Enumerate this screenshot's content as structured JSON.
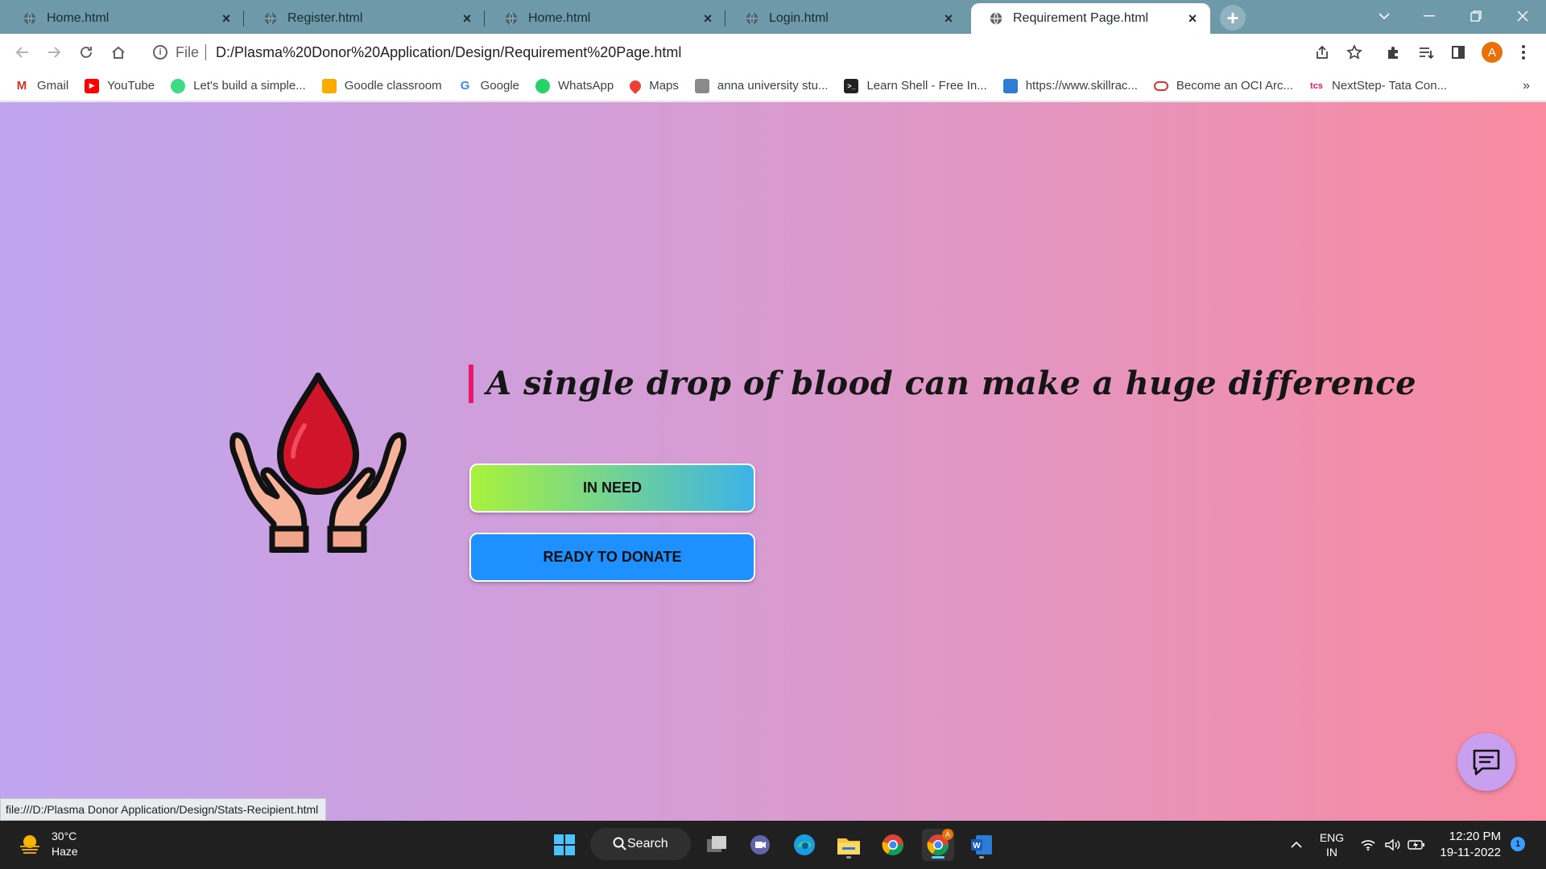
{
  "browser": {
    "tabs": [
      {
        "title": "Home.html",
        "active": false
      },
      {
        "title": "Register.html",
        "active": false
      },
      {
        "title": "Home.html",
        "active": false
      },
      {
        "title": "Login.html",
        "active": false
      },
      {
        "title": "Requirement Page.html",
        "active": true
      }
    ],
    "address": {
      "scheme": "File",
      "url": "D:/Plasma%20Donor%20Application/Design/Requirement%20Page.html"
    },
    "profile_initial": "A",
    "bookmarks": [
      {
        "label": "Gmail",
        "icon": "gmail-icon"
      },
      {
        "label": "YouTube",
        "icon": "youtube-icon"
      },
      {
        "label": "Let's build a simple...",
        "icon": "android-icon"
      },
      {
        "label": "Goodle classroom",
        "icon": "classroom-icon"
      },
      {
        "label": "Google",
        "icon": "google-icon"
      },
      {
        "label": "WhatsApp",
        "icon": "whatsapp-icon"
      },
      {
        "label": "Maps",
        "icon": "maps-pin-icon"
      },
      {
        "label": "anna university stu...",
        "icon": "university-icon"
      },
      {
        "label": "Learn Shell - Free In...",
        "icon": "terminal-icon"
      },
      {
        "label": "https://www.skillrac...",
        "icon": "skillrack-icon"
      },
      {
        "label": "Become an OCI Arc...",
        "icon": "oracle-icon"
      },
      {
        "label": "NextStep- Tata Con...",
        "icon": "tcs-icon"
      }
    ],
    "bookmarks_more": "»"
  },
  "page": {
    "headline": "A single drop of blood can make a huge difference",
    "buttons": {
      "in_need": "IN NEED",
      "ready_to_donate": "READY TO DONATE"
    },
    "status_url": "file:///D:/Plasma Donor Application/Design/Stats-Recipient.html"
  },
  "taskbar": {
    "weather": {
      "temp": "30°C",
      "condition": "Haze"
    },
    "search_label": "Search",
    "language": {
      "line1": "ENG",
      "line2": "IN"
    },
    "time": "12:20 PM",
    "date": "19-11-2022",
    "notification_count": "1",
    "chrome_badge": "A"
  },
  "colors": {
    "gradient_left": "#bfa5ef",
    "gradient_mid": "#d99bd0",
    "gradient_right": "#f98aa0",
    "accent_bar": "#e8186c",
    "in_need_gradient": [
      "#a8f23c",
      "#3db3e8"
    ],
    "donate_button": "#1e90ff",
    "blood_drop": "#d0142a",
    "hands": "#f7b39a"
  }
}
